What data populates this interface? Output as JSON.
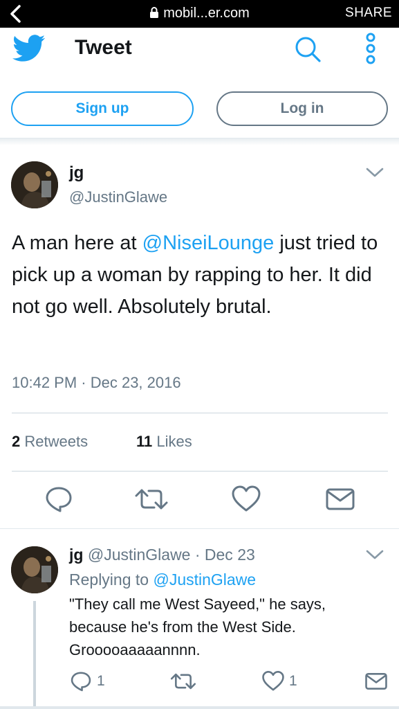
{
  "browser": {
    "url": "mobil...er.com",
    "share_label": "SHARE"
  },
  "header": {
    "title": "Tweet",
    "icons": [
      "back-icon",
      "lock-icon",
      "twitter-bird-icon",
      "search-icon",
      "more-vertical-icon"
    ]
  },
  "auth": {
    "signup_label": "Sign up",
    "login_label": "Log in"
  },
  "tweet": {
    "author_name": "jg",
    "author_handle": "@JustinGlawe",
    "text_before": "A man here at ",
    "mention": "@NiseiLounge",
    "text_after": " just tried to pick up a woman by rapping to her. It did not go well. Absolutely brutal.",
    "timestamp": "10:42 PM · Dec 23, 2016",
    "retweets_count": "2",
    "retweets_label": "Retweets",
    "likes_count": "11",
    "likes_label": "Likes"
  },
  "reply": {
    "author_name": "jg",
    "author_handle": "@JustinGlawe",
    "date": "· Dec 23",
    "replying_prefix": "Replying to ",
    "replying_to": "@JustinGlawe",
    "text": "\"They call me West Sayeed,\" he says, because he's from the West Side. Grooooaaaaannnn.",
    "reply_count": "1",
    "like_count": "1"
  },
  "colors": {
    "brand_blue": "#1da1f2",
    "text_primary": "#14171a",
    "text_secondary": "#657786",
    "border": "#ccd6dd"
  }
}
